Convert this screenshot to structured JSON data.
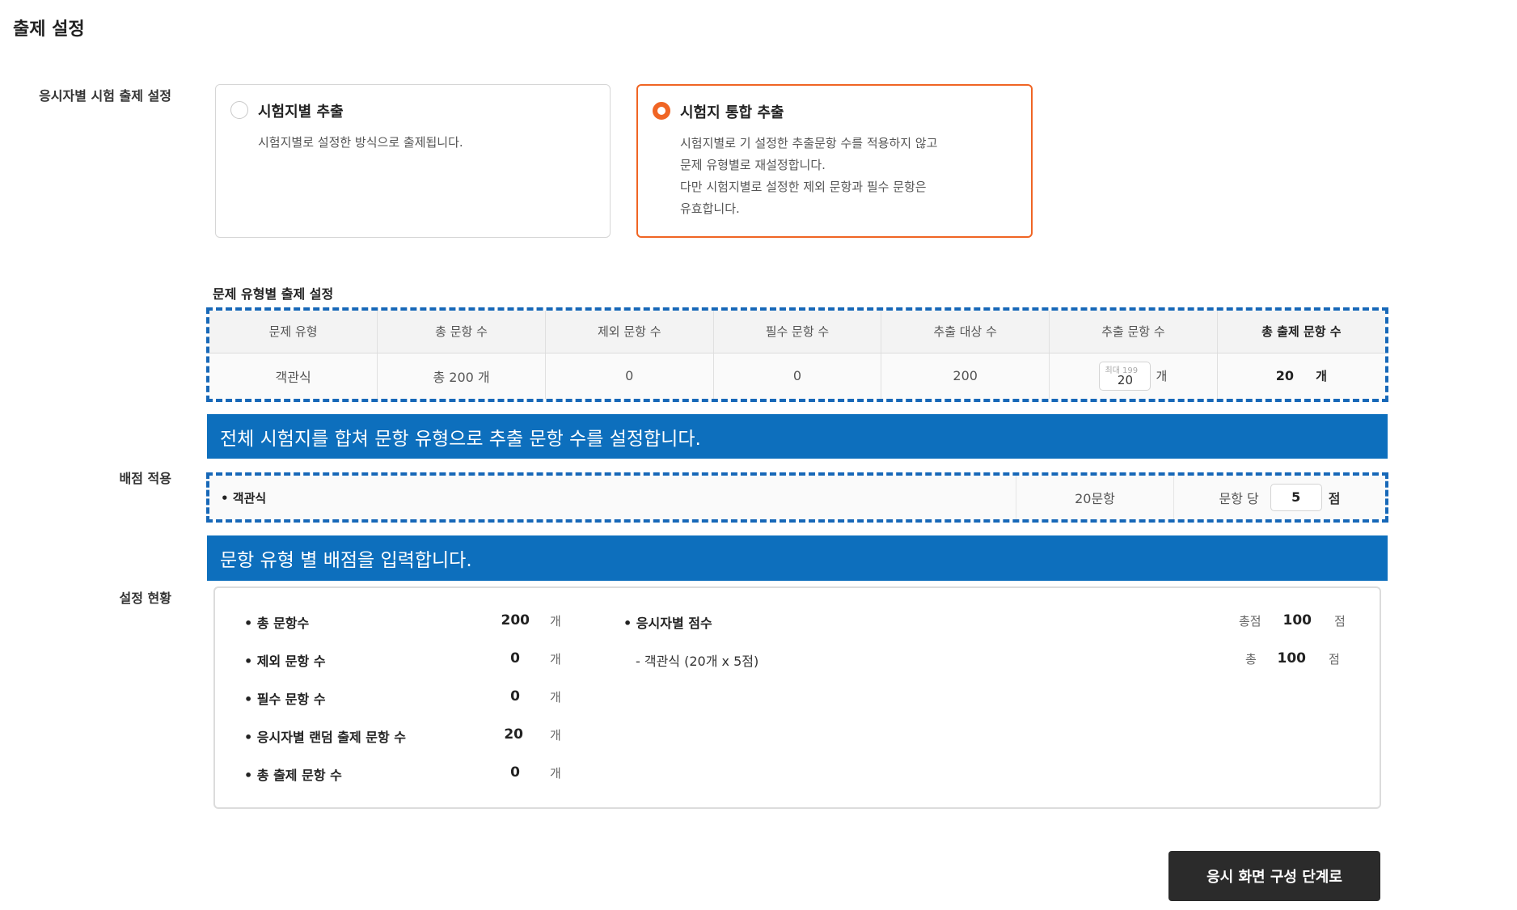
{
  "page": {
    "title": "출제 설정"
  },
  "mode_section": {
    "label": "응시자별 시험 출제 설정",
    "options": [
      {
        "title": "시험지별 추출",
        "desc": "시험지별로 설정한 방식으로 출제됩니다.",
        "selected": false
      },
      {
        "title": "시험지 통합 추출",
        "desc": "시험지별로 기 설정한 추출문항 수를 적용하지 않고\n문제 유형별로 재설정합니다.\n다만 시험지별로 설정한 제외 문항과 필수 문항은\n유효합니다.",
        "selected": true
      }
    ]
  },
  "type_section": {
    "heading": "문제 유형별 출제 설정",
    "headers": [
      "문제 유형",
      "총 문항 수",
      "제외 문항 수",
      "필수 문항 수",
      "추출 대상 수",
      "추출 문항 수",
      "총 출제 문항 수"
    ],
    "row": {
      "type": "객관식",
      "total": "총 200 개",
      "excluded": "0",
      "required": "0",
      "target": "200",
      "extract_hint": "최대 199",
      "extract_value": "20",
      "extract_unit": "개",
      "total_out": "20",
      "total_out_unit": "개"
    },
    "banner": "전체 시험지를 합쳐 문항 유형으로 추출 문항 수를 설정합니다."
  },
  "score_section": {
    "label": "배점 적용",
    "row": {
      "type": "• 객관식",
      "count": "20문항",
      "per_label": "문항 당",
      "per_value": "5",
      "unit": "점"
    },
    "banner": "문항 유형 별 배점을 입력합니다."
  },
  "status_section": {
    "label": "설정 현황",
    "left": [
      {
        "label": "• 총 문항수",
        "value": "200",
        "unit": "개"
      },
      {
        "label": "• 제외 문항 수",
        "value": "0",
        "unit": "개"
      },
      {
        "label": "• 필수 문항 수",
        "value": "0",
        "unit": "개"
      },
      {
        "label": "• 응시자별 랜덤 출제 문항 수",
        "value": "20",
        "unit": "개"
      },
      {
        "label": "• 총 출제 문항 수",
        "value": "0",
        "unit": "개"
      }
    ],
    "right": {
      "title": "• 응시자별 점수",
      "total_label": "총점",
      "total_value": "100",
      "total_unit": "점",
      "sub_label": "- 객관식 (20개 x 5점)",
      "sub_prefix": "총",
      "sub_value": "100",
      "sub_unit": "점"
    }
  },
  "footer": {
    "next_button": "응시 화면 구성 단계로"
  },
  "colors": {
    "accent": "#f06524",
    "banner": "#0d6fbd",
    "dashed": "#1768b8",
    "button": "#2b2b2b"
  }
}
